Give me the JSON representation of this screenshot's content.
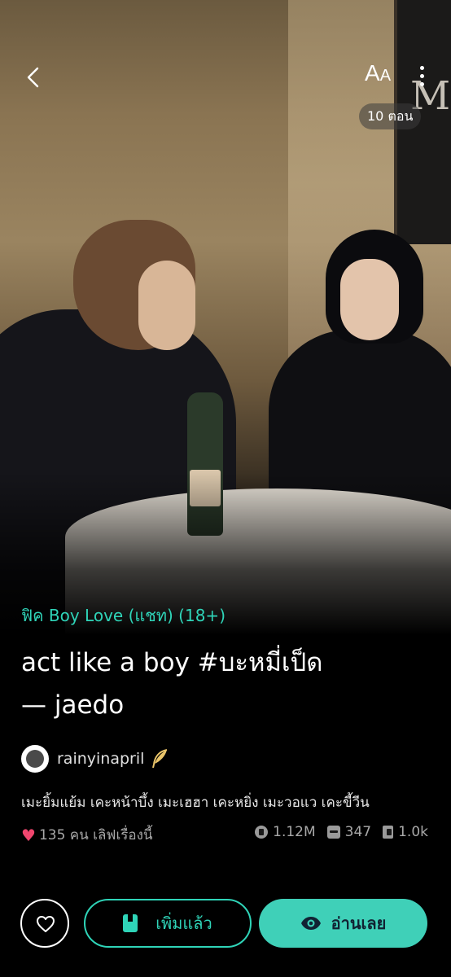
{
  "header": {
    "font_label_big": "A",
    "font_label_small": "A",
    "episode_badge": "10 ตอน"
  },
  "cover": {
    "frame_text": "M"
  },
  "story": {
    "category": "ฟิค Boy Love (แชท) (18+)",
    "title_line1": "act like a boy #บะหมี่เป็ด",
    "title_line2": "— jaedo",
    "author": "rainyinapril",
    "description": "เมะยิ้มแย้ม เคะหน้าบึ้ง เมะเฮฮา เคะหยิ่ง เมะวอแว เคะขี้วีน",
    "likes_text": "135 คน เลิฟเรื่องนี้",
    "views": "1.12M",
    "comments": "347",
    "chapters_read": "1.0k"
  },
  "actions": {
    "added_label": "เพิ่มแล้ว",
    "read_label": "อ่านเลย"
  },
  "colors": {
    "accent": "#2fd4b8",
    "heart": "#f0466e"
  }
}
